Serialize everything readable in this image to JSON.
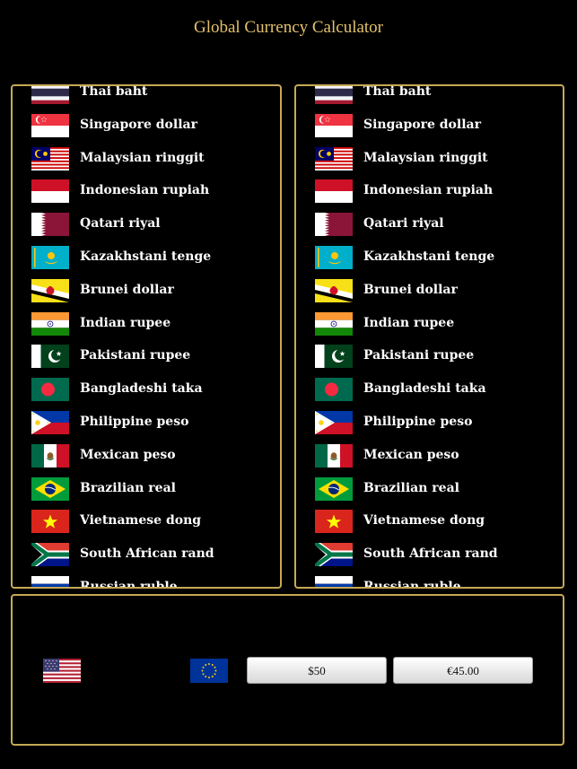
{
  "app": {
    "title": "Global Currency Calculator"
  },
  "currencies": [
    {
      "name": "Thai baht",
      "flag": "thailand-flag-icon"
    },
    {
      "name": "Singapore dollar",
      "flag": "singapore-flag-icon"
    },
    {
      "name": "Malaysian ringgit",
      "flag": "malaysia-flag-icon"
    },
    {
      "name": "Indonesian rupiah",
      "flag": "indonesia-flag-icon"
    },
    {
      "name": "Qatari riyal",
      "flag": "qatar-flag-icon"
    },
    {
      "name": "Kazakhstani tenge",
      "flag": "kazakhstan-flag-icon"
    },
    {
      "name": "Brunei dollar",
      "flag": "brunei-flag-icon"
    },
    {
      "name": "Indian rupee",
      "flag": "india-flag-icon"
    },
    {
      "name": "Pakistani rupee",
      "flag": "pakistan-flag-icon"
    },
    {
      "name": "Bangladeshi taka",
      "flag": "bangladesh-flag-icon"
    },
    {
      "name": "Philippine peso",
      "flag": "philippines-flag-icon"
    },
    {
      "name": "Mexican peso",
      "flag": "mexico-flag-icon"
    },
    {
      "name": "Brazilian real",
      "flag": "brazil-flag-icon"
    },
    {
      "name": "Vietnamese dong",
      "flag": "vietnam-flag-icon"
    },
    {
      "name": "South African rand",
      "flag": "south-africa-flag-icon"
    },
    {
      "name": "Russian ruble",
      "flag": "russia-flag-icon"
    }
  ],
  "converter": {
    "from_flag": "usa-flag-icon",
    "to_flag": "eu-flag-icon",
    "from_amount": "$50",
    "to_amount": "€45.00"
  },
  "colors": {
    "background": "#000000",
    "accent_gold": "#c7a955",
    "title_gold": "#e2c16a"
  }
}
